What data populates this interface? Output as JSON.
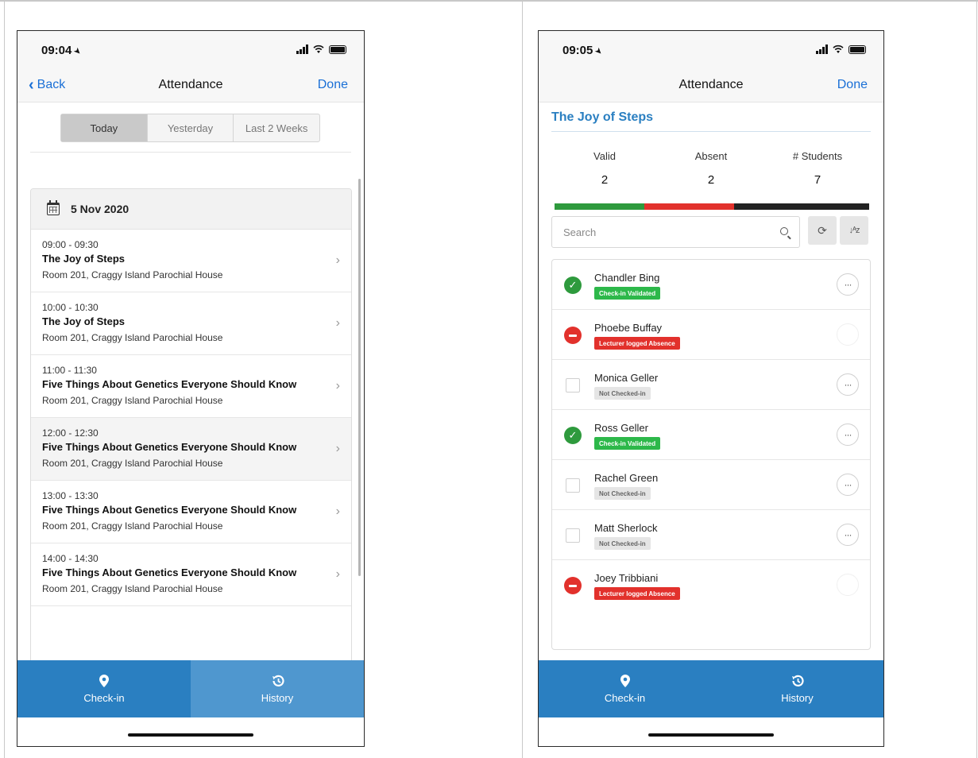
{
  "left": {
    "status": {
      "time": "09:04"
    },
    "nav": {
      "back": "Back",
      "title": "Attendance",
      "done": "Done"
    },
    "segments": [
      "Today",
      "Yesterday",
      "Last 2 Weeks"
    ],
    "active_segment": "Today",
    "date_header": "5 Nov 2020",
    "sessions": [
      {
        "time": "09:00 - 09:30",
        "name": "The Joy of Steps",
        "room": "Room 201, Craggy Island Parochial House"
      },
      {
        "time": "10:00 - 10:30",
        "name": "The Joy of Steps",
        "room": "Room 201, Craggy Island Parochial House"
      },
      {
        "time": "11:00 - 11:30",
        "name": "Five Things About Genetics Everyone Should Know",
        "room": "Room 201, Craggy Island Parochial House"
      },
      {
        "time": "12:00 - 12:30",
        "name": "Five Things About Genetics Everyone Should Know",
        "room": "Room 201, Craggy Island Parochial House"
      },
      {
        "time": "13:00 - 13:30",
        "name": "Five Things About Genetics Everyone Should Know",
        "room": "Room 201, Craggy Island Parochial House"
      },
      {
        "time": "14:00 - 14:30",
        "name": "Five Things About Genetics Everyone Should Know",
        "room": "Room 201, Craggy Island Parochial House"
      }
    ],
    "tabs": {
      "checkin": "Check-in",
      "history": "History"
    },
    "selected_tab": "History"
  },
  "right": {
    "status": {
      "time": "09:05"
    },
    "nav": {
      "title": "Attendance",
      "done": "Done"
    },
    "course": "The Joy of Steps",
    "stats": {
      "valid_label": "Valid",
      "valid": "2",
      "absent_label": "Absent",
      "absent": "2",
      "students_label": "# Students",
      "students": "7"
    },
    "search": {
      "placeholder": "Search"
    },
    "students": [
      {
        "name": "Chandler Bing",
        "status": "Check-in Validated"
      },
      {
        "name": "Phoebe Buffay",
        "status": "Lecturer logged Absence"
      },
      {
        "name": "Monica Geller",
        "status": "Not Checked-in"
      },
      {
        "name": "Ross Geller",
        "status": "Check-in Validated"
      },
      {
        "name": "Rachel Green",
        "status": "Not Checked-in"
      },
      {
        "name": "Matt Sherlock",
        "status": "Not Checked-in"
      },
      {
        "name": "Joey Tribbiani",
        "status": "Lecturer logged Absence"
      }
    ],
    "tabs": {
      "checkin": "Check-in",
      "history": "History"
    }
  },
  "colors": {
    "accent": "#2a7fc1",
    "valid": "#2e9a3d",
    "absent": "#e2312c",
    "link": "#1a6fd6"
  },
  "icons": [
    "location-pin-icon",
    "history-icon",
    "calendar-icon",
    "search-icon",
    "refresh-icon",
    "sort-icon",
    "more-icon"
  ]
}
